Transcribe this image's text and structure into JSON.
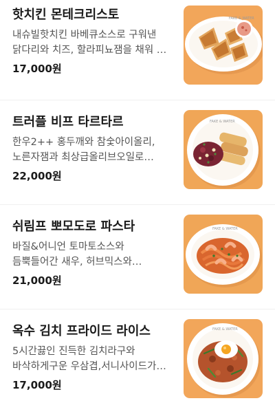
{
  "menu": {
    "items": [
      {
        "name": "핫치킨 몬테크리스토",
        "description": "내슈빌핫치킨 바베큐소스로 구워낸 닭다리와 치즈, 할라피뇨잼을 채워 …",
        "price": "17,000원",
        "photo_icon": "monte-cristo-sandwich-photo",
        "photo_bg": "#f2a65a"
      },
      {
        "name": "트러플 비프 타르타르",
        "description": "한우2++ 홍두깨와 참숯아이올리, 노른자잼과 최상급올리브오일로 만든…",
        "price": "22,000원",
        "photo_icon": "beef-tartare-photo",
        "photo_bg": "#f0a657"
      },
      {
        "name": "쉬림프 뽀모도로 파스타",
        "description": "바질&어니언 토마토소스와 듬뿍들어간 새우, 허브믹스와 레몬제스트가 …",
        "price": "21,000원",
        "photo_icon": "shrimp-pomodoro-pasta-photo",
        "photo_bg": "#f0a657"
      },
      {
        "name": "옥수 김치 프라이드 라이스",
        "description": "5시간끓인 진득한 김치라구와 바삭하게구운 우삼겹,서니사이드가 올라…",
        "price": "17,000원",
        "photo_icon": "kimchi-fried-rice-photo",
        "photo_bg": "#f2a65a"
      }
    ]
  },
  "plate_brand": "FAKE & WATER"
}
